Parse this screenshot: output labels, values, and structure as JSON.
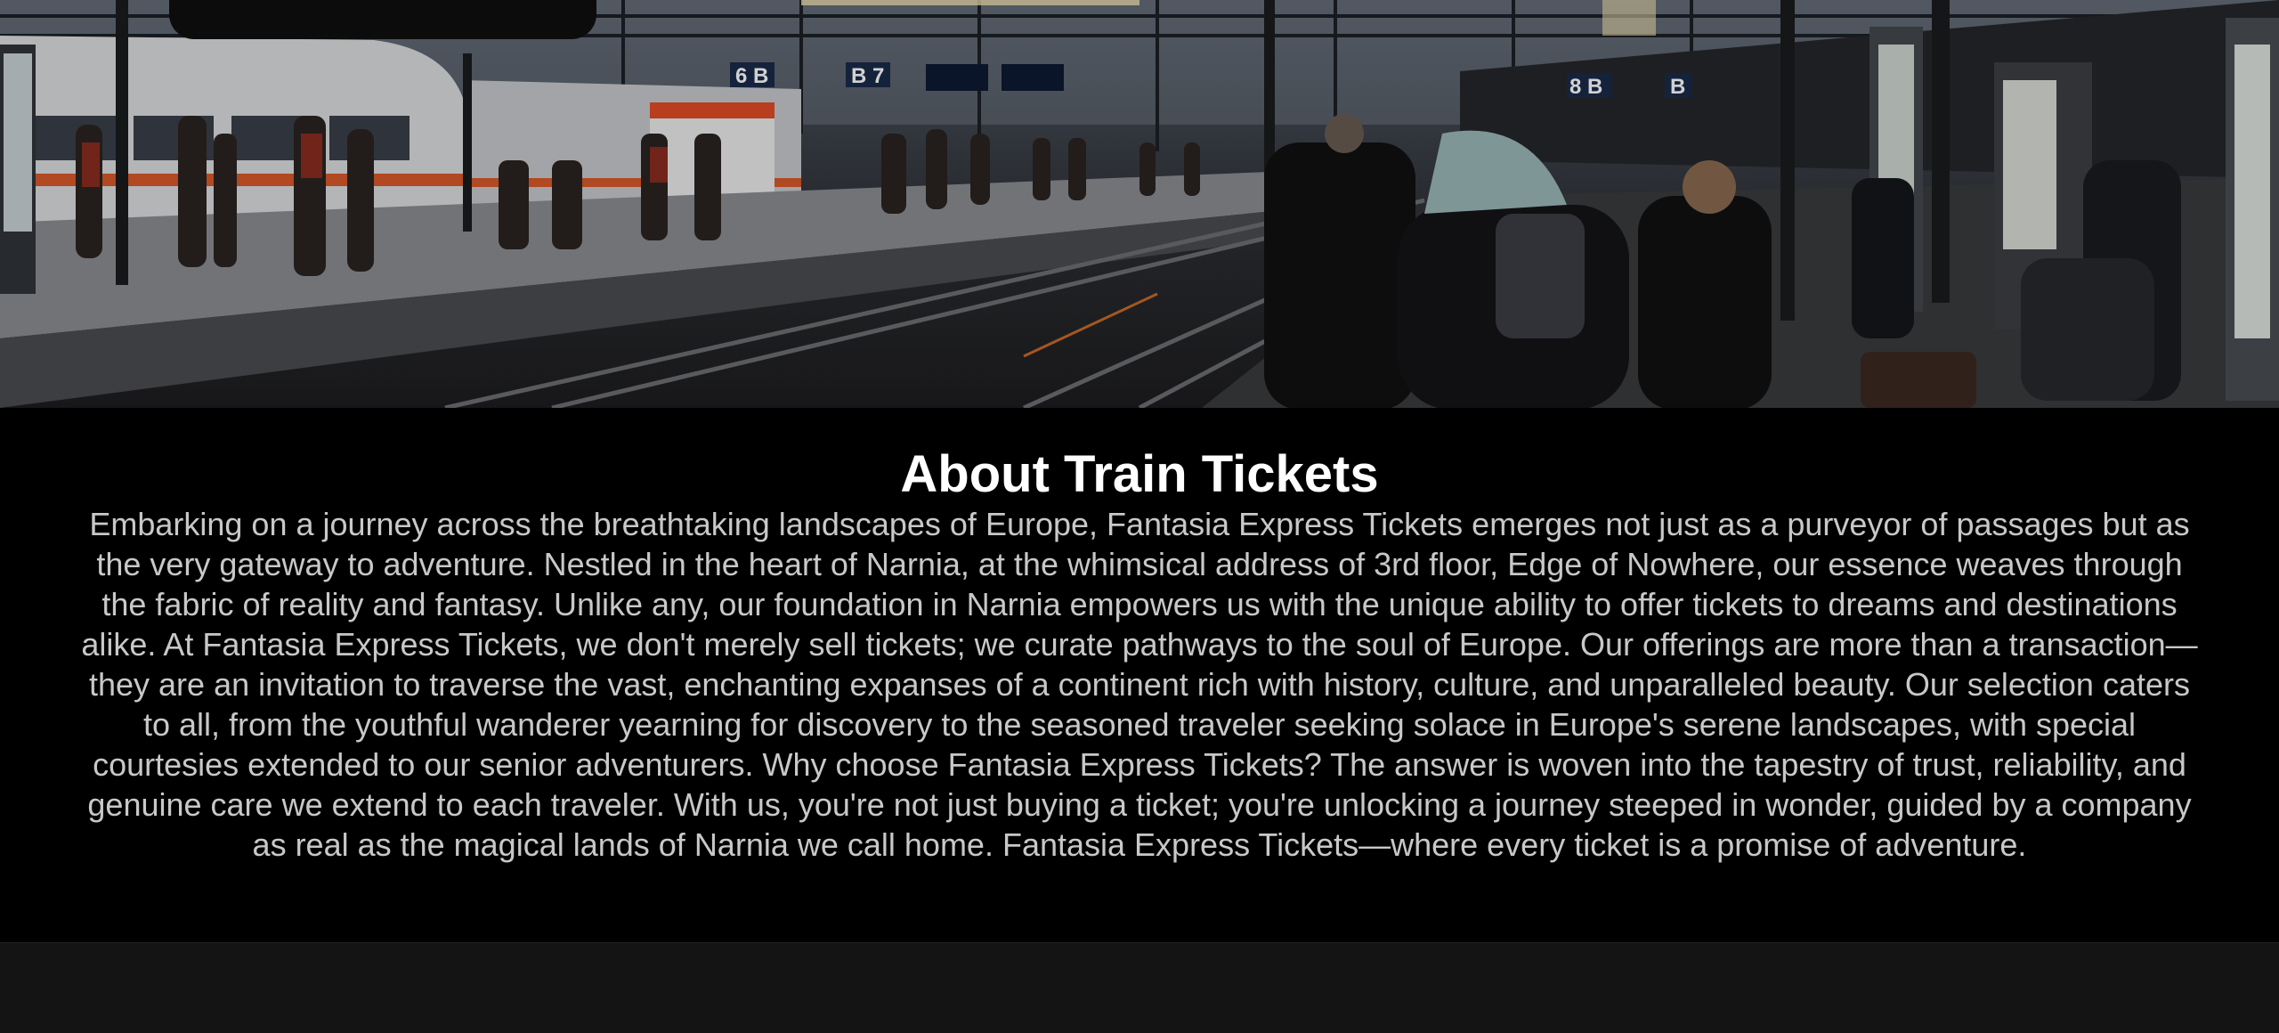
{
  "hero": {
    "image": "train-station-platform-photo",
    "platform_signs": [
      "6 B",
      "B 7",
      "8 B",
      "B"
    ]
  },
  "about": {
    "title": "About Train Tickets",
    "body": "Embarking on a journey across the breathtaking landscapes of Europe, Fantasia Express Tickets emerges not just as a purveyor of passages but as the very gateway to adventure. Nestled in the heart of Narnia, at the whimsical address of 3rd floor, Edge of Nowhere, our essence weaves through the fabric of reality and fantasy. Unlike any, our foundation in Narnia empowers us with the unique ability to offer tickets to dreams and destinations alike. At Fantasia Express Tickets, we don't merely sell tickets; we curate pathways to the soul of Europe. Our offerings are more than a transaction—they are an invitation to traverse the vast, enchanting expanses of a continent rich with history, culture, and unparalleled beauty. Our selection caters to all, from the youthful wanderer yearning for discovery to the seasoned traveler seeking solace in Europe's serene landscapes, with special courtesies extended to our senior adventurers. Why choose Fantasia Express Tickets? The answer is woven into the tapestry of trust, reliability, and genuine care we extend to each traveler. With us, you're not just buying a ticket; you're unlocking a journey steeped in wonder, guided by a company as real as the magical lands of Narnia we call home. Fantasia Express Tickets—where every ticket is a promise of adventure."
  },
  "colors": {
    "section_bg": "#000000",
    "title": "#ffffff",
    "body_text": "#c8c8c8",
    "footer_bg": "#141414"
  }
}
